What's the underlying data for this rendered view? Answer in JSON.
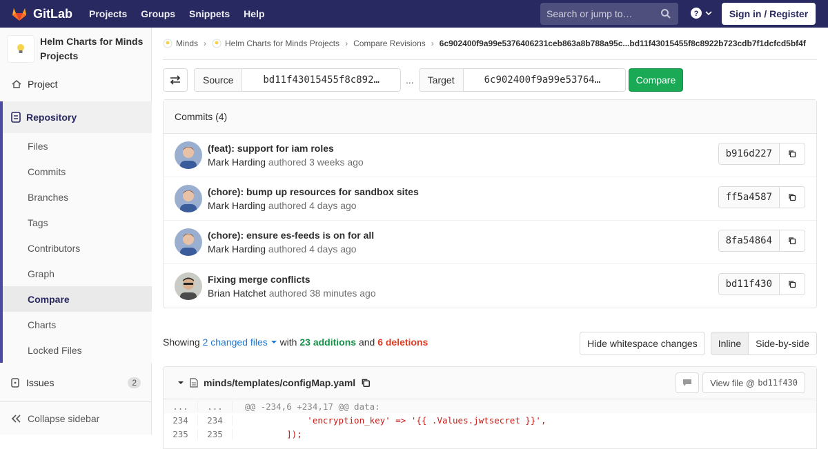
{
  "topbar": {
    "brand": "GitLab",
    "nav": [
      "Projects",
      "Groups",
      "Snippets",
      "Help"
    ],
    "search_placeholder": "Search or jump to…",
    "signin": "Sign in / Register"
  },
  "sidebar": {
    "project_name": "Helm Charts for Minds Projects",
    "project": "Project",
    "repository": "Repository",
    "repo_items": [
      "Files",
      "Commits",
      "Branches",
      "Tags",
      "Contributors",
      "Graph",
      "Compare",
      "Charts",
      "Locked Files"
    ],
    "active_item": "Compare",
    "issues": "Issues",
    "issues_count": "2",
    "collapse": "Collapse sidebar"
  },
  "breadcrumb": {
    "items": [
      "Minds",
      "Helm Charts for Minds Projects",
      "Compare Revisions"
    ],
    "current": "6c902400f9a99e5376406231ceb863a8b788a95c...bd11f43015455f8c8922b723cdb7f1dcfcd5bf4f"
  },
  "compare": {
    "source_label": "Source",
    "source_value": "bd11f43015455f8c892…",
    "dots": "...",
    "target_label": "Target",
    "target_value": "6c902400f9a99e53764…",
    "compare_button": "Compare"
  },
  "commits": {
    "header": "Commits (4)",
    "authored_word": "authored",
    "list": [
      {
        "title": "(feat): support for iam roles",
        "author": "Mark Harding",
        "time": "3 weeks ago",
        "sha": "b916d227"
      },
      {
        "title": "(chore): bump up resources for sandbox sites",
        "author": "Mark Harding",
        "time": "4 days ago",
        "sha": "ff5a4587"
      },
      {
        "title": "(chore): ensure es-feeds is on for all",
        "author": "Mark Harding",
        "time": "4 days ago",
        "sha": "8fa54864"
      },
      {
        "title": "Fixing merge conflicts",
        "author": "Brian Hatchet",
        "time": "38 minutes ago",
        "sha": "bd11f430"
      }
    ]
  },
  "stats": {
    "showing": "Showing",
    "changed_files": "2 changed files",
    "with": "with",
    "additions": "23 additions",
    "and": "and",
    "deletions": "6 deletions"
  },
  "diff_buttons": {
    "whitespace": "Hide whitespace changes",
    "inline": "Inline",
    "side_by_side": "Side-by-side"
  },
  "file": {
    "path": "minds/templates/configMap.yaml",
    "view_file": "View file @",
    "view_sha": "bd11f430",
    "lines": [
      {
        "old": "...",
        "new": "...",
        "code": "@@ -234,6 +234,17 @@ data:",
        "type": "match"
      },
      {
        "old": "234",
        "new": "234",
        "code": "            'encryption_key' => '{{ .Values.jwtsecret }}',",
        "type": "normal"
      },
      {
        "old": "235",
        "new": "235",
        "code": "        ]);",
        "type": "normal"
      }
    ]
  },
  "colors": {
    "topbar": "#292961",
    "accent": "#4b4ba3",
    "compare_green": "#1aaa55",
    "link_blue": "#1f78d1",
    "deletions_red": "#db3b21"
  }
}
